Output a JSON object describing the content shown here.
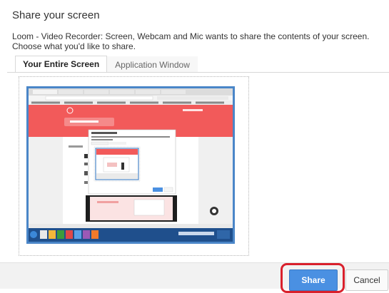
{
  "dialog": {
    "title": "Share your screen",
    "description": "Loom - Video Recorder: Screen, Webcam and Mic wants to share the contents of your screen. Choose what you'd like to share."
  },
  "tabs": [
    {
      "label": "Your Entire Screen",
      "active": true
    },
    {
      "label": "Application Window",
      "active": false
    }
  ],
  "buttons": {
    "share_label": "Share",
    "cancel_label": "Cancel"
  },
  "colors": {
    "share": "#4a90e2",
    "selection_border": "#4a86c8",
    "highlight": "#d9202c",
    "loom_brand": "#f25a5a"
  }
}
